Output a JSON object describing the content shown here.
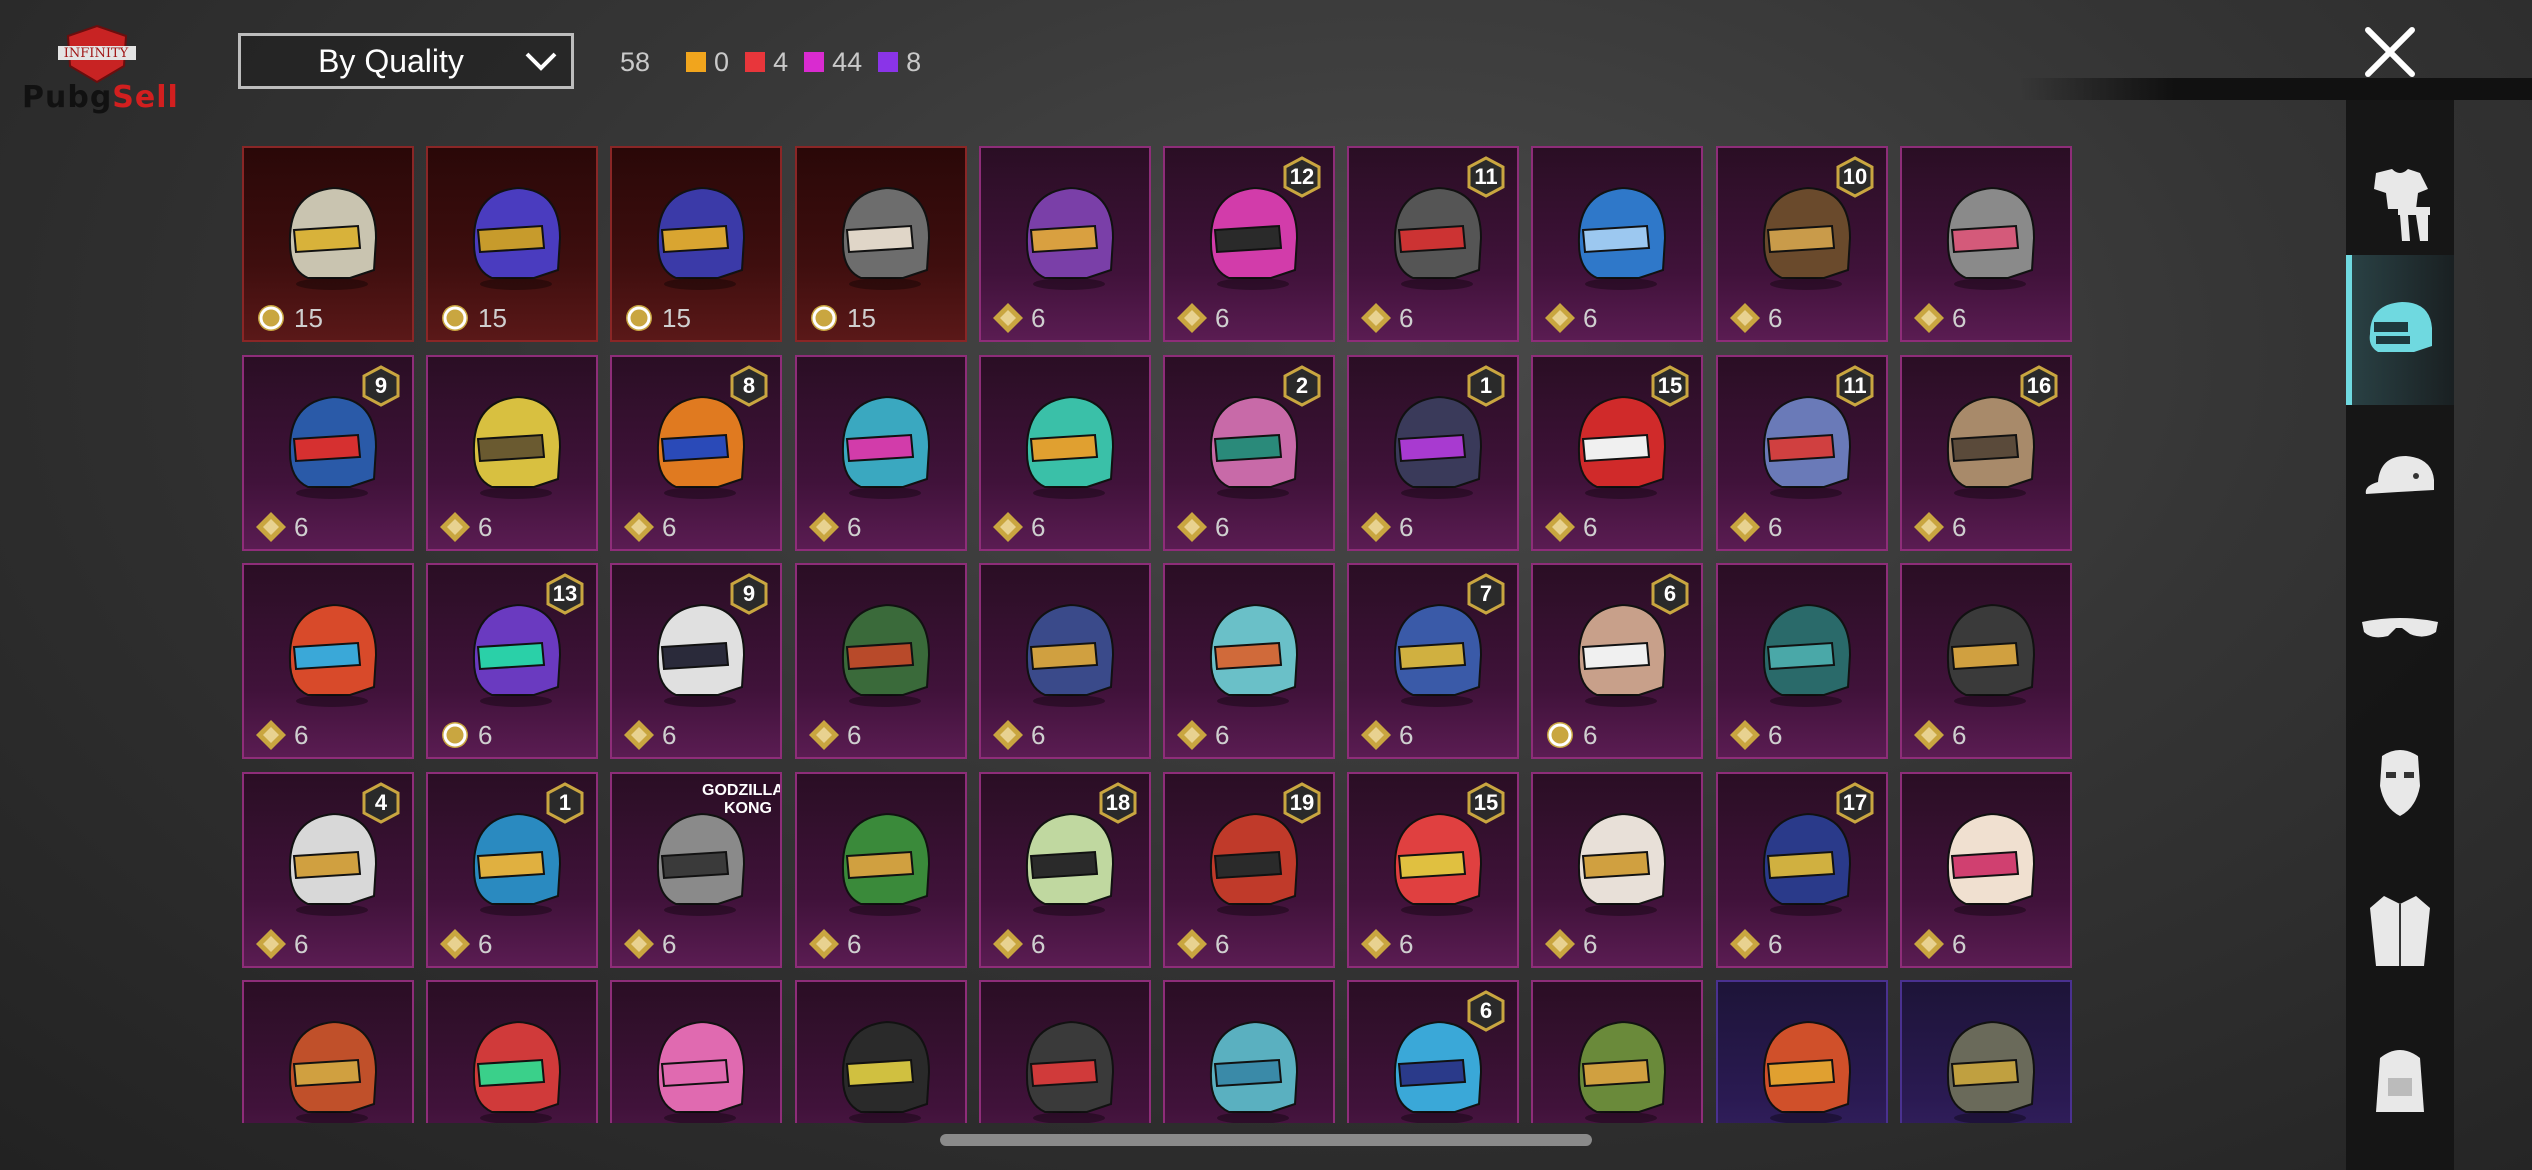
{
  "logo": {
    "top_text": "INFINITY",
    "brand": "Pubg",
    "brand_tail": "Sell"
  },
  "sort": {
    "selected": "By Quality"
  },
  "counts": {
    "total": "58",
    "tiers": [
      {
        "color": "#f1a51d",
        "value": "0"
      },
      {
        "color": "#e8363b",
        "value": "4"
      },
      {
        "color": "#d92bd0",
        "value": "44"
      },
      {
        "color": "#8a34e8",
        "value": "8"
      }
    ]
  },
  "sidebar": {
    "items": [
      {
        "icon": "outfit-icon"
      },
      {
        "icon": "helmet-icon",
        "active": true
      },
      {
        "icon": "cap-icon"
      },
      {
        "icon": "glasses-icon"
      },
      {
        "icon": "mask-icon"
      },
      {
        "icon": "jacket-icon"
      },
      {
        "icon": "backpack-icon"
      }
    ]
  },
  "accent": "#6fd9e0",
  "items": [
    {
      "tier": "red",
      "cost": "15",
      "level": "",
      "coin": "spin",
      "color": "#c9c4b0",
      "visor": "#d8b23a"
    },
    {
      "tier": "red",
      "cost": "15",
      "level": "",
      "coin": "spin",
      "color": "#4a3cbf",
      "visor": "#c79b2c"
    },
    {
      "tier": "red",
      "cost": "15",
      "level": "",
      "coin": "spin",
      "color": "#3b3aa8",
      "visor": "#d9a531"
    },
    {
      "tier": "red",
      "cost": "15",
      "level": "",
      "coin": "spin",
      "color": "#6d6d6d",
      "visor": "#e0d6c8"
    },
    {
      "tier": "mag",
      "cost": "6",
      "level": "",
      "coin": "diamond",
      "color": "#7a3fa8",
      "visor": "#d9a040"
    },
    {
      "tier": "mag",
      "cost": "6",
      "level": "12",
      "coin": "diamond",
      "color": "#d23caa",
      "visor": "#2a2a2a"
    },
    {
      "tier": "mag",
      "cost": "6",
      "level": "11",
      "coin": "diamond",
      "color": "#555",
      "visor": "#c33"
    },
    {
      "tier": "mag",
      "cost": "6",
      "level": "",
      "coin": "diamond",
      "color": "#2f78c9",
      "visor": "#9cc8f0"
    },
    {
      "tier": "mag",
      "cost": "6",
      "level": "10",
      "coin": "diamond",
      "color": "#6a4a2c",
      "visor": "#c99b4a"
    },
    {
      "tier": "mag",
      "cost": "6",
      "level": "",
      "coin": "diamond",
      "color": "#8a8a8a",
      "visor": "#d45a7a"
    },
    {
      "tier": "mag",
      "cost": "6",
      "level": "9",
      "coin": "diamond",
      "color": "#2a5aa8",
      "visor": "#d63030"
    },
    {
      "tier": "mag",
      "cost": "6",
      "level": "",
      "coin": "diamond",
      "color": "#d8c040",
      "visor": "#6a5a30"
    },
    {
      "tier": "mag",
      "cost": "6",
      "level": "8",
      "coin": "diamond",
      "color": "#e07a20",
      "visor": "#2a4ab8"
    },
    {
      "tier": "mag",
      "cost": "6",
      "level": "",
      "coin": "diamond",
      "color": "#3aa8c0",
      "visor": "#d23caa"
    },
    {
      "tier": "mag",
      "cost": "6",
      "level": "",
      "coin": "diamond",
      "color": "#3ac0a8",
      "visor": "#e0a030"
    },
    {
      "tier": "mag",
      "cost": "6",
      "level": "2",
      "coin": "diamond",
      "color": "#c86aa8",
      "visor": "#2a8a7a"
    },
    {
      "tier": "mag",
      "cost": "6",
      "level": "1",
      "coin": "diamond",
      "color": "#3a3a5a",
      "visor": "#a83ad0"
    },
    {
      "tier": "mag",
      "cost": "6",
      "level": "15",
      "coin": "diamond",
      "color": "#d02a2a",
      "visor": "#f0f0f0"
    },
    {
      "tier": "mag",
      "cost": "6",
      "level": "11",
      "coin": "diamond",
      "color": "#6a7ab8",
      "visor": "#d04040"
    },
    {
      "tier": "mag",
      "cost": "6",
      "level": "16",
      "coin": "diamond",
      "color": "#a88a6a",
      "visor": "#5a4a3a"
    },
    {
      "tier": "mag",
      "cost": "6",
      "level": "",
      "coin": "diamond",
      "color": "#d84a2a",
      "visor": "#3aa8d8"
    },
    {
      "tier": "mag",
      "cost": "6",
      "level": "13",
      "coin": "spin",
      "color": "#6a3ac0",
      "visor": "#2ad0a8"
    },
    {
      "tier": "mag",
      "cost": "6",
      "level": "9",
      "coin": "diamond",
      "color": "#e0e0e0",
      "visor": "#2a2a3a"
    },
    {
      "tier": "mag",
      "cost": "6",
      "level": "",
      "coin": "diamond",
      "color": "#3a6a3a",
      "visor": "#b84a2a"
    },
    {
      "tier": "mag",
      "cost": "6",
      "level": "",
      "coin": "diamond",
      "color": "#3a4a8a",
      "visor": "#d0a040"
    },
    {
      "tier": "mag",
      "cost": "6",
      "level": "",
      "coin": "diamond",
      "color": "#6ac0c8",
      "visor": "#d06a3a"
    },
    {
      "tier": "mag",
      "cost": "6",
      "level": "7",
      "coin": "diamond",
      "color": "#3a5aa8",
      "visor": "#d0b040"
    },
    {
      "tier": "mag",
      "cost": "6",
      "level": "6",
      "coin": "spin",
      "color": "#c8a08a",
      "visor": "#f0f0f0"
    },
    {
      "tier": "mag",
      "cost": "6",
      "level": "",
      "coin": "diamond",
      "color": "#2a6a6a",
      "visor": "#4aa8a8"
    },
    {
      "tier": "mag",
      "cost": "6",
      "level": "",
      "coin": "diamond",
      "color": "#3a3a3a",
      "visor": "#d0a040"
    },
    {
      "tier": "mag",
      "cost": "6",
      "level": "4",
      "coin": "diamond",
      "color": "#d8d8d8",
      "visor": "#d0a040"
    },
    {
      "tier": "mag",
      "cost": "6",
      "level": "1",
      "coin": "diamond",
      "color": "#2a8ac0",
      "visor": "#e0b040"
    },
    {
      "tier": "mag",
      "cost": "6",
      "level": "",
      "coin": "diamond",
      "color": "#8a8a8a",
      "visor": "#3a3a3a",
      "label": "GODZILLA KONG"
    },
    {
      "tier": "mag",
      "cost": "6",
      "level": "",
      "coin": "diamond",
      "color": "#3a8a3a",
      "visor": "#d0a040"
    },
    {
      "tier": "mag",
      "cost": "6",
      "level": "18",
      "coin": "diamond",
      "color": "#c0d8a0",
      "visor": "#2a2a2a"
    },
    {
      "tier": "mag",
      "cost": "6",
      "level": "19",
      "coin": "diamond",
      "color": "#c03a2a",
      "visor": "#2a2a2a"
    },
    {
      "tier": "mag",
      "cost": "6",
      "level": "15",
      "coin": "diamond",
      "color": "#e04040",
      "visor": "#e0c040"
    },
    {
      "tier": "mag",
      "cost": "6",
      "level": "",
      "coin": "diamond",
      "color": "#e8e0d8",
      "visor": "#d0a040"
    },
    {
      "tier": "mag",
      "cost": "6",
      "level": "17",
      "coin": "diamond",
      "color": "#2a3a8a",
      "visor": "#d0b040"
    },
    {
      "tier": "mag",
      "cost": "6",
      "level": "",
      "coin": "diamond",
      "color": "#f0e0d0",
      "visor": "#d04070"
    },
    {
      "tier": "mag",
      "cost": "",
      "level": "",
      "coin": "",
      "color": "#c0502a",
      "visor": "#d0a040"
    },
    {
      "tier": "mag",
      "cost": "",
      "level": "",
      "coin": "",
      "color": "#d03a3a",
      "visor": "#3ad08a"
    },
    {
      "tier": "mag",
      "cost": "",
      "level": "",
      "coin": "",
      "color": "#e06ab0",
      "visor": "#e06ab0"
    },
    {
      "tier": "mag",
      "cost": "",
      "level": "",
      "coin": "",
      "color": "#2a2a2a",
      "visor": "#d0c040"
    },
    {
      "tier": "mag",
      "cost": "",
      "level": "",
      "coin": "",
      "color": "#3a3a3a",
      "visor": "#d03a3a"
    },
    {
      "tier": "mag",
      "cost": "",
      "level": "",
      "coin": "",
      "color": "#5ab0c0",
      "visor": "#3a8aa8"
    },
    {
      "tier": "mag",
      "cost": "",
      "level": "6",
      "coin": "",
      "color": "#3aa8d8",
      "visor": "#2a3a8a"
    },
    {
      "tier": "mag",
      "cost": "",
      "level": "",
      "coin": "",
      "color": "#6a8a3a",
      "visor": "#d0a040"
    },
    {
      "tier": "purple",
      "cost": "",
      "level": "",
      "coin": "",
      "color": "#d0502a",
      "visor": "#e0a030"
    },
    {
      "tier": "purple",
      "cost": "",
      "level": "",
      "coin": "",
      "color": "#6a6a5a",
      "visor": "#c0a040"
    }
  ]
}
